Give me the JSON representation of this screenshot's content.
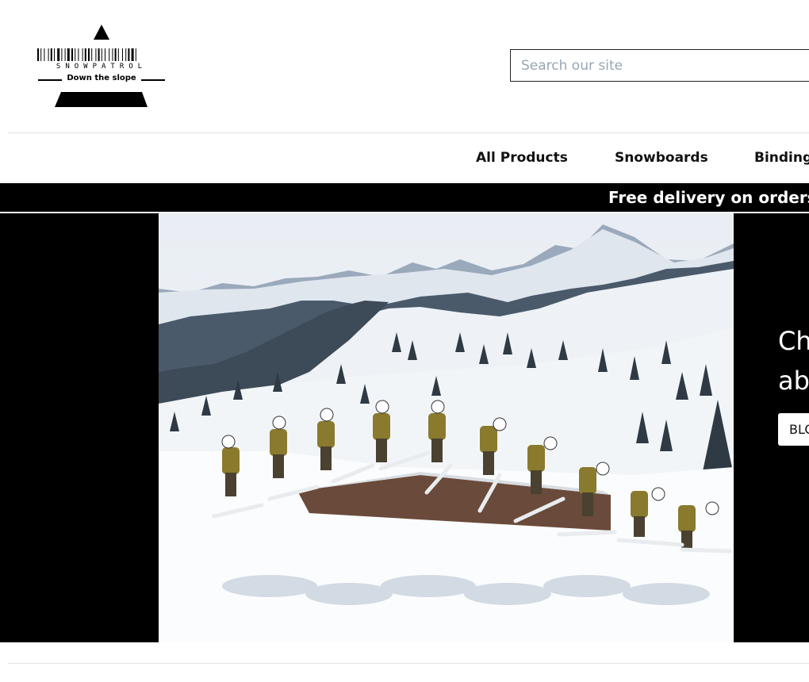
{
  "header": {
    "logo": {
      "name": "SNOWPATROL",
      "tagline": "Down the slope"
    },
    "search": {
      "placeholder": "Search our site"
    }
  },
  "nav": {
    "items": [
      {
        "label": "All Products"
      },
      {
        "label": "Snowboards"
      },
      {
        "label": "Bindings"
      }
    ]
  },
  "announcement": {
    "text": "Free delivery on orders over"
  },
  "hero": {
    "title_line1": "Check out our news",
    "title_line2": "about snowboarding",
    "button_label": "BLOG"
  },
  "colors": {
    "announcement_bg": "#000000",
    "hero_bg": "#000000",
    "text_primary": "#111111",
    "placeholder": "#98a6b3"
  }
}
